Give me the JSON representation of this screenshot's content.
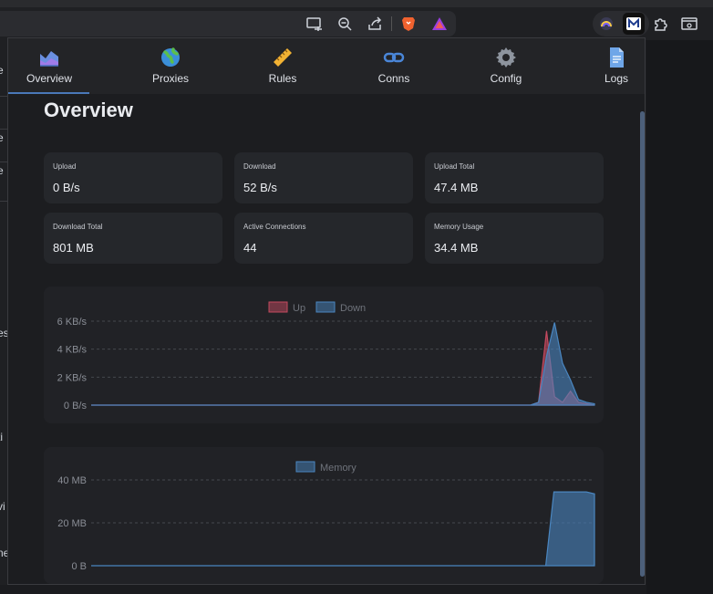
{
  "tabs": [
    {
      "label": "Overview",
      "icon": "chart-area-icon"
    },
    {
      "label": "Proxies",
      "icon": "globe-icon"
    },
    {
      "label": "Rules",
      "icon": "ruler-icon"
    },
    {
      "label": "Conns",
      "icon": "link-icon"
    },
    {
      "label": "Config",
      "icon": "gear-icon"
    },
    {
      "label": "Logs",
      "icon": "document-icon"
    }
  ],
  "active_tab": "Overview",
  "page_title": "Overview",
  "stats": [
    {
      "label": "Upload",
      "value": "0 B/s"
    },
    {
      "label": "Download",
      "value": "52 B/s"
    },
    {
      "label": "Upload Total",
      "value": "47.4 MB"
    },
    {
      "label": "Download Total",
      "value": "801 MB"
    },
    {
      "label": "Active Connections",
      "value": "44"
    },
    {
      "label": "Memory Usage",
      "value": "34.4 MB"
    }
  ],
  "left_fragments": [
    "e",
    "e",
    "e",
    "es",
    "ti",
    "vi",
    "ne"
  ],
  "colors": {
    "up": "#c4495f",
    "down": "#4a86c0",
    "memory": "#4a86c0",
    "accent": "#4a78b8"
  },
  "chart_data": [
    {
      "type": "area",
      "legend": [
        "Up",
        "Down"
      ],
      "yticks": [
        "6 KB/s",
        "4 KB/s",
        "2 KB/s",
        "0 B/s"
      ],
      "ylim": [
        0,
        6
      ],
      "yunit": "KB/s",
      "grid": true,
      "legend_position": "top",
      "series": [
        {
          "name": "Up",
          "values": [
            0,
            0,
            0,
            0,
            0,
            0,
            0,
            0,
            0,
            0,
            0,
            0,
            0,
            0,
            0,
            0,
            0,
            0,
            0,
            0,
            0,
            0,
            0,
            0,
            0,
            0,
            0,
            0,
            0,
            0,
            0,
            0,
            0,
            0,
            0,
            0,
            0,
            0,
            0,
            0,
            0,
            0,
            0,
            0,
            0,
            0,
            0,
            0,
            0,
            0,
            0,
            0,
            0,
            0,
            0,
            0,
            0.2,
            5.3,
            0.6,
            0.2,
            1.0,
            0.2,
            0.1,
            0
          ]
        },
        {
          "name": "Down",
          "values": [
            0,
            0,
            0,
            0,
            0,
            0,
            0,
            0,
            0,
            0,
            0,
            0,
            0,
            0,
            0,
            0,
            0,
            0,
            0,
            0,
            0,
            0,
            0,
            0,
            0,
            0,
            0,
            0,
            0,
            0,
            0,
            0,
            0,
            0,
            0,
            0,
            0,
            0,
            0,
            0,
            0,
            0,
            0,
            0,
            0,
            0,
            0,
            0,
            0,
            0,
            0,
            0,
            0,
            0,
            0,
            0,
            0.2,
            3.5,
            5.9,
            3.0,
            1.8,
            0.4,
            0.2,
            0.1
          ]
        }
      ]
    },
    {
      "type": "area",
      "legend": [
        "Memory"
      ],
      "yticks": [
        "40 MB",
        "20 MB",
        "0 B"
      ],
      "ylim": [
        0,
        40
      ],
      "yunit": "MB",
      "grid": true,
      "legend_position": "top",
      "series": [
        {
          "name": "Memory",
          "values": [
            0,
            0,
            0,
            0,
            0,
            0,
            0,
            0,
            0,
            0,
            0,
            0,
            0,
            0,
            0,
            0,
            0,
            0,
            0,
            0,
            0,
            0,
            0,
            0,
            0,
            0,
            0,
            0,
            0,
            0,
            0,
            0,
            0,
            0,
            0,
            0,
            0,
            0,
            0,
            0,
            0,
            0,
            0,
            0,
            0,
            0,
            0,
            0,
            0,
            0,
            0,
            0,
            0,
            0,
            0,
            0,
            0,
            34.4,
            34.4,
            34.4,
            34.4,
            34.4,
            33.5
          ]
        }
      ]
    }
  ]
}
